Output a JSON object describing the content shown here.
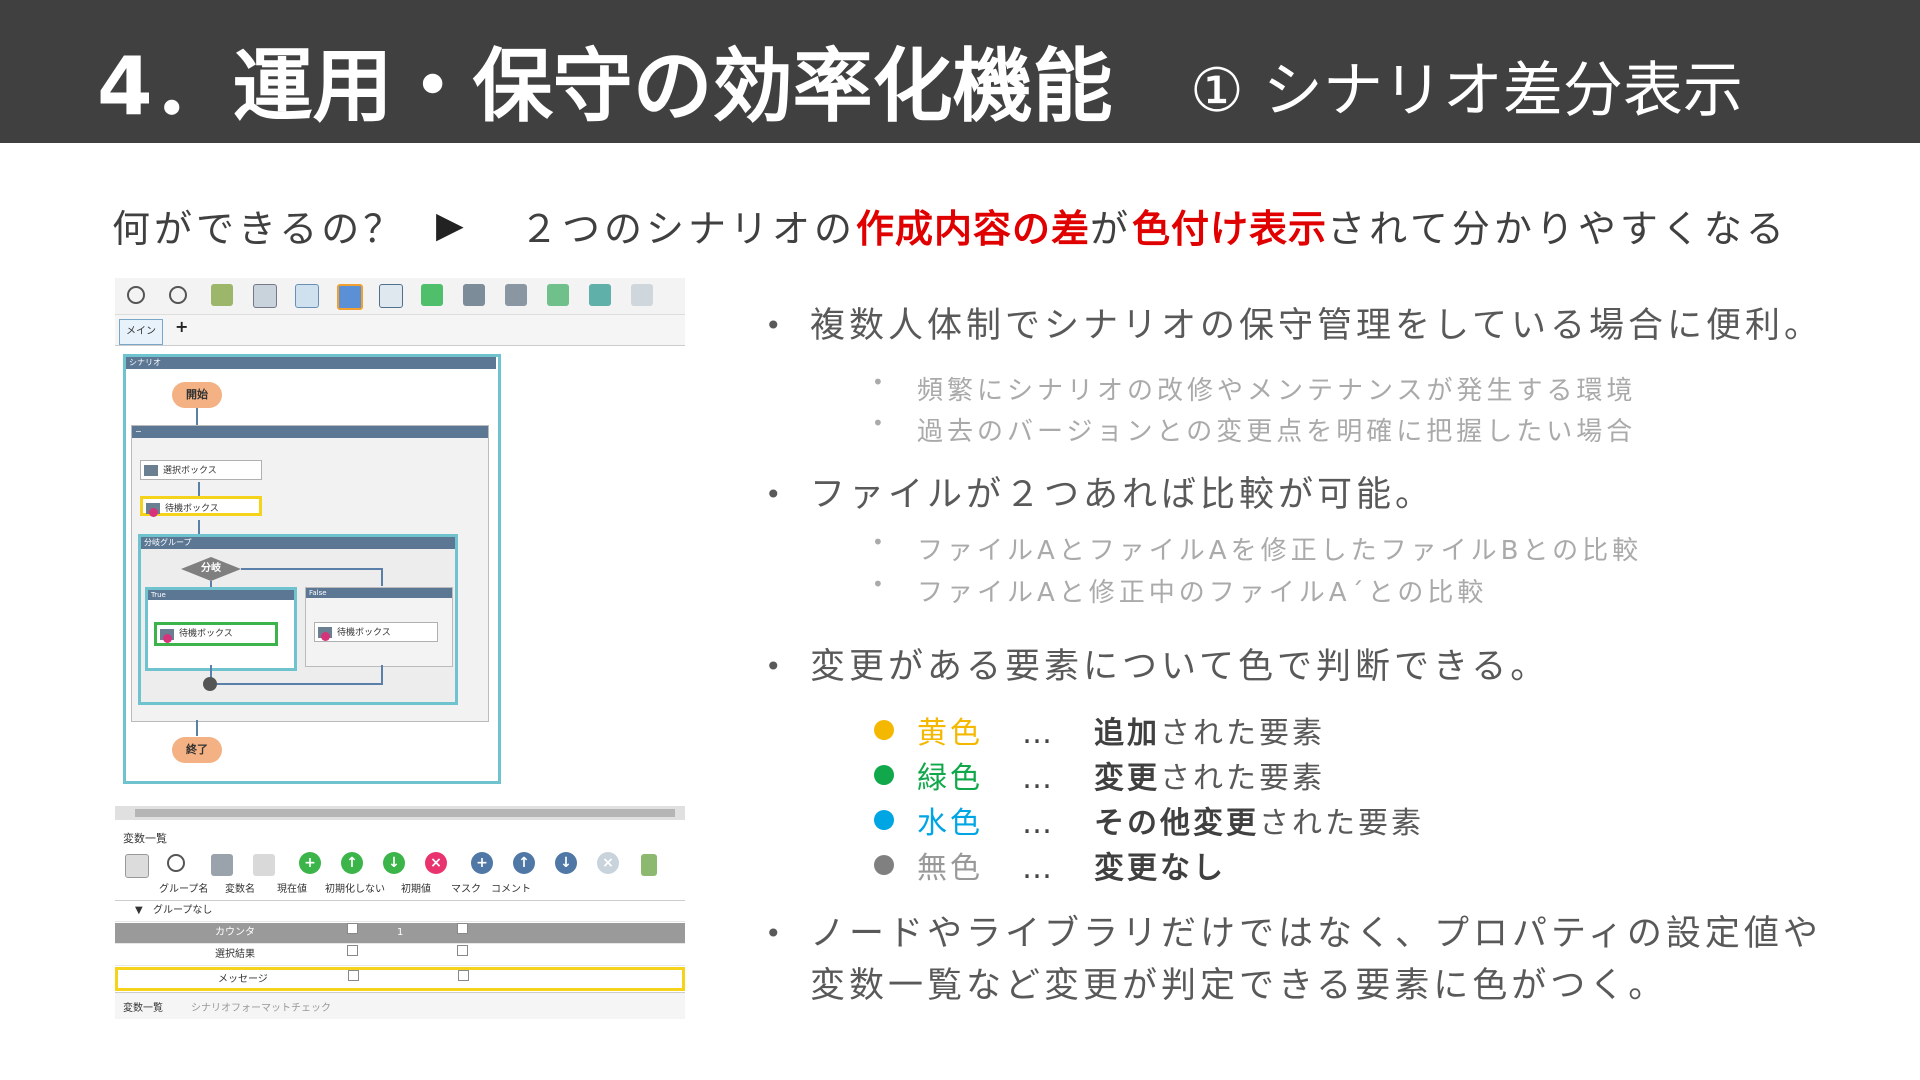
{
  "header": {
    "title": "4．運用・保守の効率化機能",
    "subtitle": "① シナリオ差分表示"
  },
  "intro": {
    "question": "何ができるの？",
    "answer_pre": "２つのシナリオの",
    "answer_hl1": "作成内容の差",
    "answer_mid": "が",
    "answer_hl2": "色付け表示",
    "answer_post": "されて分かりやすくなる"
  },
  "screenshot": {
    "tab_main": "メイン",
    "tab_plus": "+",
    "scenario_label": "シナリオ",
    "start_label": "開始",
    "end_label": "終了",
    "node_select": "選択ボックス",
    "node_wait": "待機ボックス",
    "branch_group": "分岐グループ",
    "branch_label": "分岐",
    "true_label": "True",
    "false_label": "False",
    "node_wait_true": "待機ボックス",
    "node_wait_false": "待機ボックス",
    "vars_title": "変数一覧",
    "columns": [
      "グループ名",
      "変数名",
      "現在値",
      "初期化しない",
      "初期値",
      "マスク",
      "コメント"
    ],
    "group_row": "グループなし",
    "rows": [
      {
        "name": "カウンタ",
        "init": "1"
      },
      {
        "name": "選択結果",
        "init": ""
      },
      {
        "name": "メッセージ",
        "init": ""
      }
    ],
    "bottom_tab1": "変数一覧",
    "bottom_tab2": "シナリオフォーマットチェック"
  },
  "bullets": {
    "b1": "複数人体制でシナリオの保守管理をしている場合に便利。",
    "b1_sub1": "頻繁にシナリオの改修やメンテナンスが発生する環境",
    "b1_sub2": "過去のバージョンとの変更点を明確に把握したい場合",
    "b2": "ファイルが２つあれば比較が可能。",
    "b2_sub1": "ファイルAとファイルAを修正したファイルBとの比較",
    "b2_sub2": "ファイルAと修正中のファイルA´との比較",
    "b3": "変更がある要素について色で判断できる。",
    "b4_line1": "ノードやライブラリだけではなく、プロパティの設定値や",
    "b4_line2": "変数一覧など変更が判定できる要素に色がつく。"
  },
  "legend": [
    {
      "color_name": "黄色",
      "ellipsis": "…",
      "bold": "追加",
      "rest": "された要素",
      "color": "#f5b800"
    },
    {
      "color_name": "緑色",
      "ellipsis": "…",
      "bold": "変更",
      "rest": "された要素",
      "color": "#10a84a"
    },
    {
      "color_name": "水色",
      "ellipsis": "…",
      "bold": "その他変更",
      "rest": "された要素",
      "color": "#00a5e3"
    },
    {
      "color_name": "無色",
      "ellipsis": "…",
      "bold": "変更なし",
      "rest": "",
      "color": "#808080"
    }
  ],
  "colors": {
    "header_bg": "#404040",
    "highlight_red": "#e00000",
    "added_yellow": "#f5d31a",
    "changed_green": "#3cb44b",
    "other_cyan": "#6fc3cf"
  }
}
